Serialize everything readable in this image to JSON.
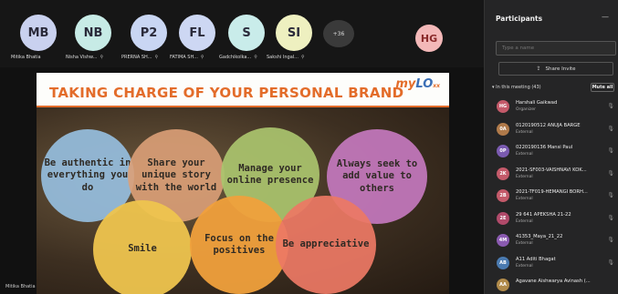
{
  "gallery": {
    "tiles": [
      {
        "initials": "MB",
        "name": "Mitika Bhatia",
        "color": "#c9d1ef"
      },
      {
        "initials": "NB",
        "name": "Nisha Vishw...",
        "color": "#c7ebe6"
      },
      {
        "initials": "P2",
        "name": "PRERNA SH...",
        "color": "#c9d6f3"
      },
      {
        "initials": "FL",
        "name": "FATIMA SH...",
        "color": "#cdd7f3"
      },
      {
        "initials": "S",
        "name": "Gadchikolka...",
        "color": "#c9ecea"
      },
      {
        "initials": "SI",
        "name": "Sakshi Ingal...",
        "color": "#eef0c0"
      }
    ],
    "more_count": "+36",
    "speaker_initials": "HG"
  },
  "slide": {
    "title": "TAKING CHARGE OF YOUR PERSONAL BRAND",
    "logo_a": "my",
    "logo_b": "LO",
    "logo_c": "xx",
    "bubbles": [
      "Be authentic in everything you do",
      "Share your unique story with the world",
      "Manage your online presence",
      "Always seek to add value to others",
      "Smile",
      "Focus on the positives",
      "Be appreciative"
    ]
  },
  "self_name": "Mitika Bhatia",
  "panel": {
    "title": "Participants",
    "minimize": "—",
    "search_placeholder": "Type a name",
    "share_label": "Share Invite",
    "section_label": "In this meeting (43)",
    "mute_all": "Mute all",
    "participants": [
      {
        "initials": "HG",
        "name": "Harshali Gaikwad",
        "role": "Organizer",
        "color": "#c45a6a"
      },
      {
        "initials": "0A",
        "name": "0120190512 ANUJA BARGE",
        "role": "External",
        "color": "#b07a4a"
      },
      {
        "initials": "0P",
        "name": "0220190136 Mansi Paul",
        "role": "External",
        "color": "#7a5ab0"
      },
      {
        "initials": "2K",
        "name": "2021-SF003-VAISHNAVI KOK...",
        "role": "External",
        "color": "#c45a6a"
      },
      {
        "initials": "2B",
        "name": "2021-TF019-HEMANGI BORH...",
        "role": "External",
        "color": "#c45a6a"
      },
      {
        "initials": "2E",
        "name": "29 641 APEKSHA 21-22",
        "role": "External",
        "color": "#b04a6a"
      },
      {
        "initials": "4M",
        "name": "41353_Maya_21_22",
        "role": "External",
        "color": "#8a5ab0"
      },
      {
        "initials": "AB",
        "name": "A11 Aditi Bhagat",
        "role": "External",
        "color": "#4a7ab0"
      },
      {
        "initials": "AA",
        "name": "Agavane Aishwarya Avinash (...",
        "role": "",
        "color": "#b08a4a"
      }
    ]
  }
}
